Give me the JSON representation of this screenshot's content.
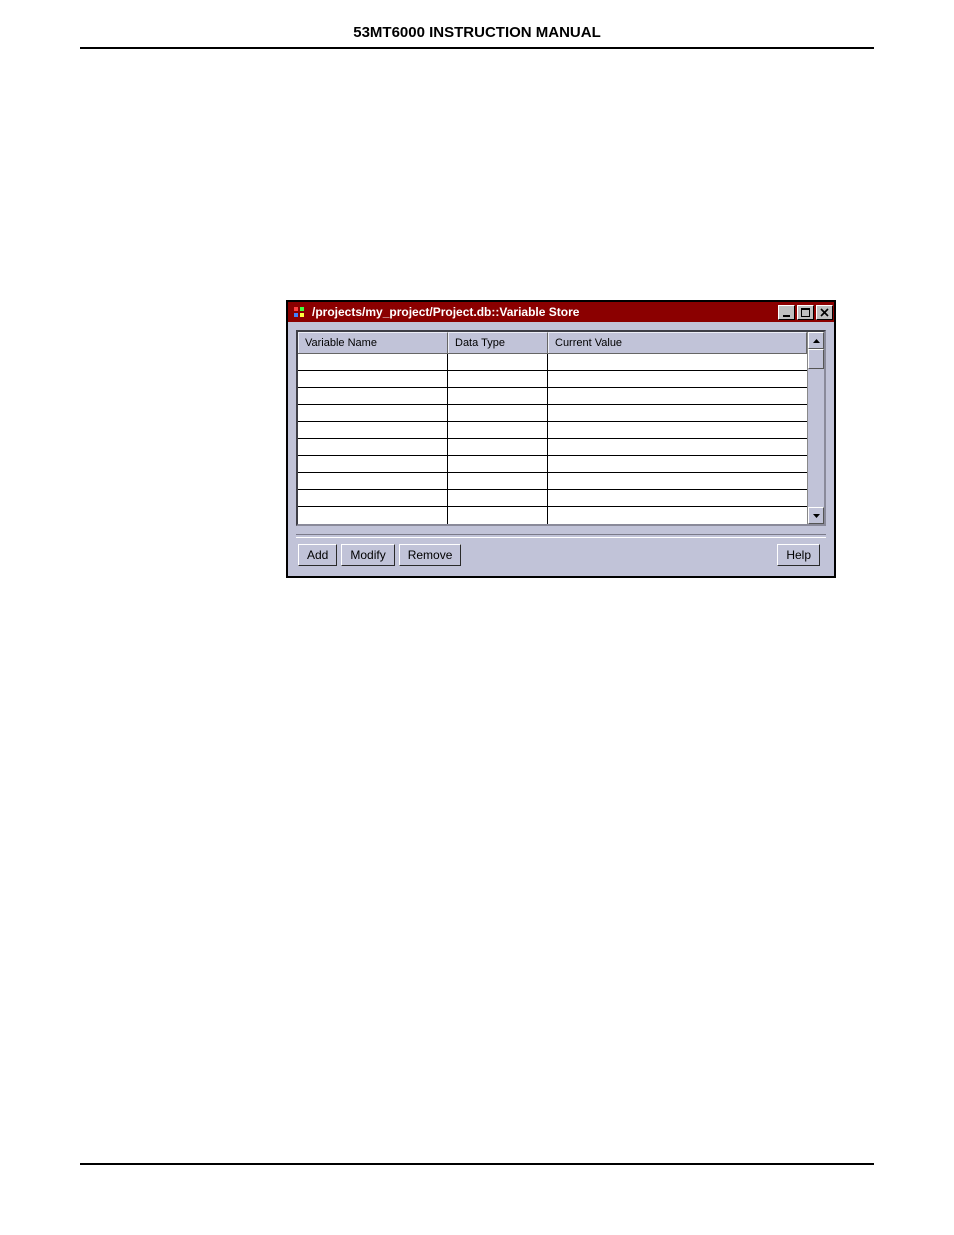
{
  "page": {
    "header": "53MT6000 INSTRUCTION MANUAL"
  },
  "window": {
    "title": "/projects/my_project/Project.db::Variable Store"
  },
  "table": {
    "columns": {
      "name": "Variable Name",
      "type": "Data Type",
      "value": "Current Value"
    },
    "rows": [
      {
        "name": "",
        "type": "",
        "value": ""
      },
      {
        "name": "",
        "type": "",
        "value": ""
      },
      {
        "name": "",
        "type": "",
        "value": ""
      },
      {
        "name": "",
        "type": "",
        "value": ""
      },
      {
        "name": "",
        "type": "",
        "value": ""
      },
      {
        "name": "",
        "type": "",
        "value": ""
      },
      {
        "name": "",
        "type": "",
        "value": ""
      },
      {
        "name": "",
        "type": "",
        "value": ""
      },
      {
        "name": "",
        "type": "",
        "value": ""
      },
      {
        "name": "",
        "type": "",
        "value": ""
      }
    ]
  },
  "buttons": {
    "add": "Add",
    "modify": "Modify",
    "remove": "Remove",
    "help": "Help"
  }
}
